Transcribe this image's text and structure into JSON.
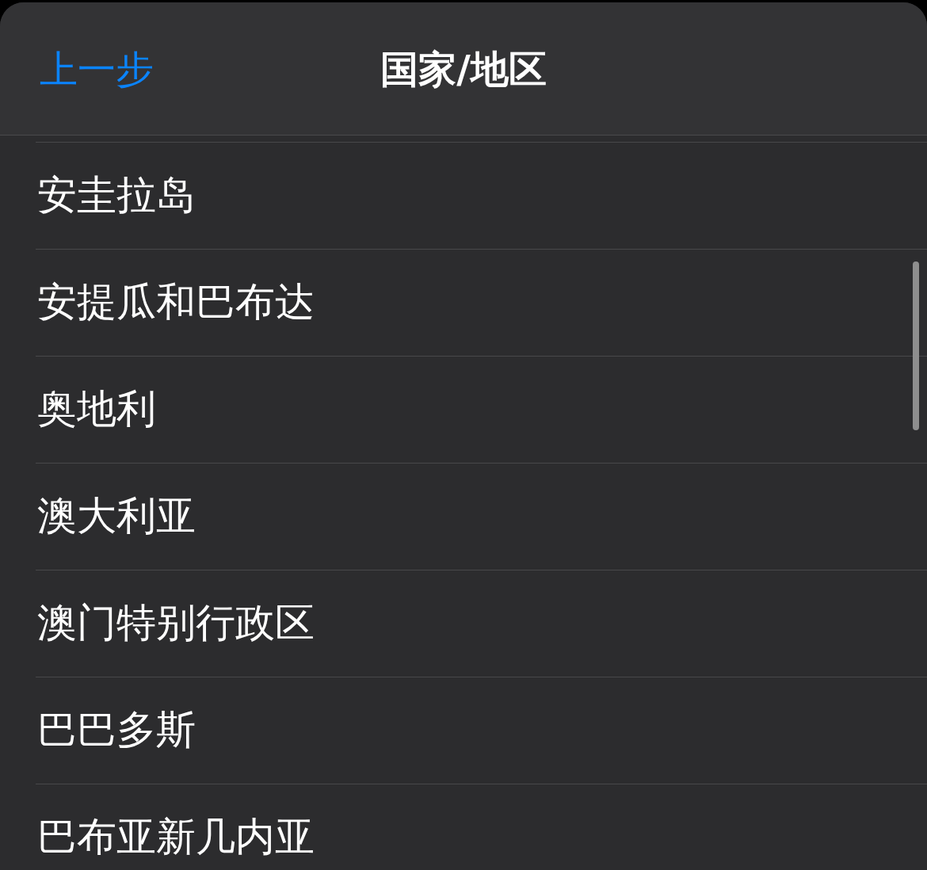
{
  "header": {
    "back_button": "上一步",
    "title": "国家/地区"
  },
  "list": {
    "items": [
      {
        "label": "安圭拉岛"
      },
      {
        "label": "安提瓜和巴布达"
      },
      {
        "label": "奥地利"
      },
      {
        "label": "澳大利亚"
      },
      {
        "label": "澳门特别行政区"
      },
      {
        "label": "巴巴多斯"
      },
      {
        "label": "巴布亚新几内亚"
      }
    ]
  }
}
